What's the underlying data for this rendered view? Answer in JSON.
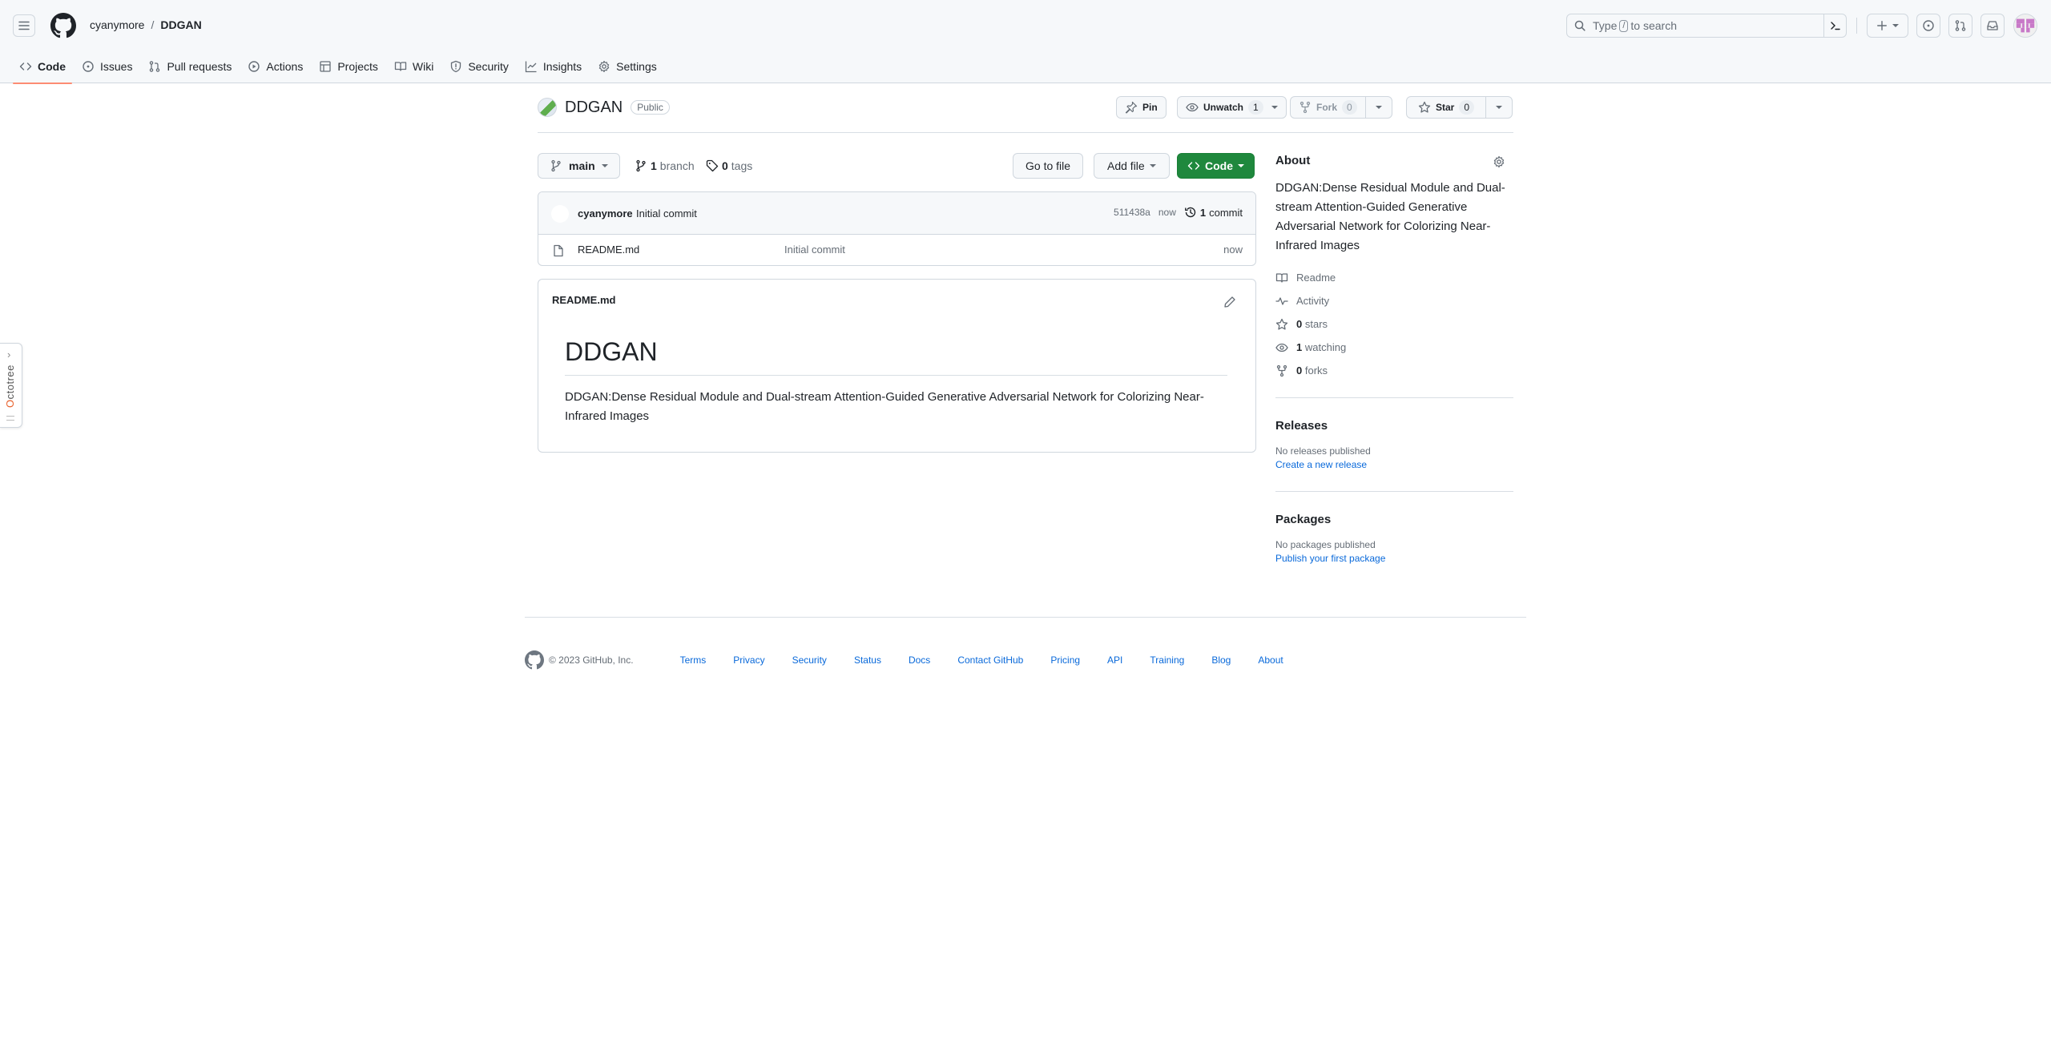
{
  "header": {
    "owner": "cyanymore",
    "separator": "/",
    "repo": "DDGAN",
    "search": {
      "prefix": "Type",
      "key": "/",
      "suffix": "to search"
    }
  },
  "repo_nav": [
    {
      "label": "Code",
      "icon": "code-icon",
      "selected": true
    },
    {
      "label": "Issues",
      "icon": "issue-icon"
    },
    {
      "label": "Pull requests",
      "icon": "pull-request-icon"
    },
    {
      "label": "Actions",
      "icon": "play-icon"
    },
    {
      "label": "Projects",
      "icon": "table-icon"
    },
    {
      "label": "Wiki",
      "icon": "book-icon"
    },
    {
      "label": "Security",
      "icon": "shield-icon"
    },
    {
      "label": "Insights",
      "icon": "graph-icon"
    },
    {
      "label": "Settings",
      "icon": "gear-icon"
    }
  ],
  "octotree": {
    "label_first": "O",
    "label_rest": "ctotree"
  },
  "repo": {
    "name": "DDGAN",
    "visibility": "Public",
    "actions": {
      "pin": "Pin",
      "unwatch": "Unwatch",
      "watch_count": "1",
      "fork": "Fork",
      "fork_count": "0",
      "star": "Star",
      "star_count": "0"
    }
  },
  "branch": {
    "current": "main",
    "branch_count": "1",
    "branch_label": "branch",
    "tag_count": "0",
    "tag_label": "tags",
    "goto_file": "Go to file",
    "add_file": "Add file",
    "code": "Code"
  },
  "latest_commit": {
    "author": "cyanymore",
    "message": "Initial commit",
    "sha": "511438a",
    "age": "now",
    "commit_count": "1",
    "commit_label": "commit"
  },
  "files": [
    {
      "name": "README.md",
      "message": "Initial commit",
      "age": "now"
    }
  ],
  "readme": {
    "filename": "README.md",
    "heading": "DDGAN",
    "body": "DDGAN:Dense Residual Module and Dual-stream Attention-Guided Generative Adversarial Network for Colorizing Near-Infrared Images"
  },
  "about": {
    "title": "About",
    "description": "DDGAN:Dense Residual Module and Dual-stream Attention-Guided Generative Adversarial Network for Colorizing Near-Infrared Images",
    "readme": "Readme",
    "activity": "Activity",
    "stars_count": "0",
    "stars_label": "stars",
    "watching_count": "1",
    "watching_label": "watching",
    "forks_count": "0",
    "forks_label": "forks"
  },
  "releases": {
    "title": "Releases",
    "empty": "No releases published",
    "link": "Create a new release"
  },
  "packages": {
    "title": "Packages",
    "empty": "No packages published",
    "link": "Publish your first package"
  },
  "footer": {
    "copyright": "© 2023 GitHub, Inc.",
    "links": [
      "Terms",
      "Privacy",
      "Security",
      "Status",
      "Docs",
      "Contact GitHub",
      "Pricing",
      "API",
      "Training",
      "Blog",
      "About"
    ]
  },
  "colors": {
    "primary_green": "#1f883d",
    "link_blue": "#0969da",
    "nav_underline": "#fd8c73",
    "avatar_pink": "#c879c8"
  }
}
